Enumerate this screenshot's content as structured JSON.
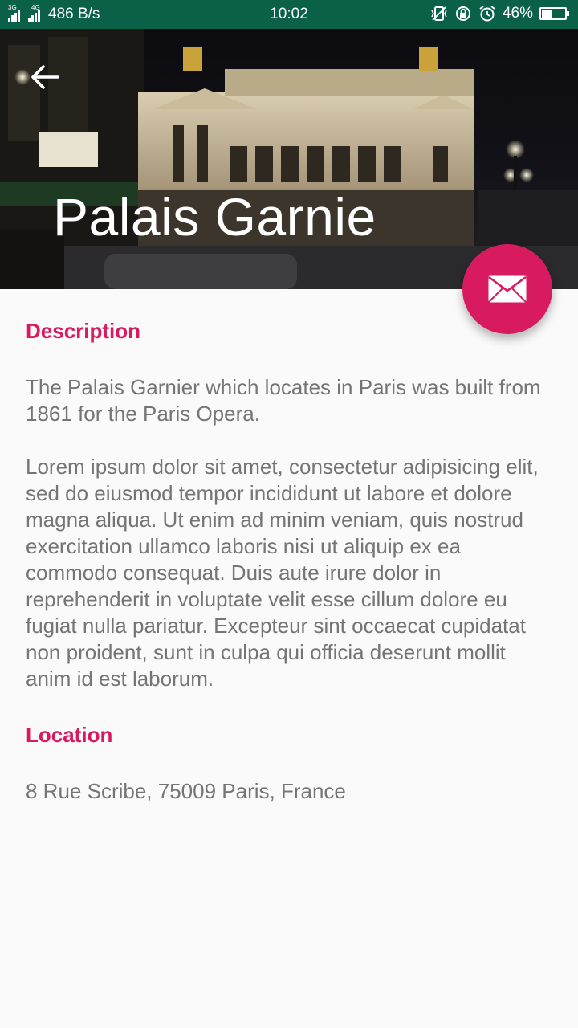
{
  "status_bar": {
    "net_label_1": "3G",
    "net_label_2": "4G",
    "speed": "486 B/s",
    "time": "10:02",
    "battery_text": "46%",
    "battery_level": 0.46
  },
  "header": {
    "title": "Palais Garnie",
    "image_icon": "palais-garnier-night-photo"
  },
  "fab": {
    "icon": "mail-icon",
    "color": "#d81b60"
  },
  "description": {
    "title": "Description",
    "paragraph_1": "The Palais Garnier which locates in Paris was built from 1861 for the Paris Opera.",
    "paragraph_2": "Lorem ipsum dolor sit amet, consectetur adipisicing elit, sed do eiusmod tempor incididunt ut labore et dolore magna aliqua. Ut enim ad minim veniam, quis nostrud exercitation ullamco laboris nisi ut aliquip ex ea commodo consequat. Duis aute irure dolor in reprehenderit in voluptate velit esse cillum dolore eu fugiat nulla pariatur. Excepteur sint occaecat cupidatat non proident, sunt in culpa qui officia deserunt mollit anim id est laborum."
  },
  "location": {
    "title": "Location",
    "address": "8 Rue Scribe, 75009 Paris, France"
  },
  "colors": {
    "accent": "#d81b60",
    "status_bar": "#0b6148",
    "body_text": "#757575",
    "background": "#fafafa"
  }
}
